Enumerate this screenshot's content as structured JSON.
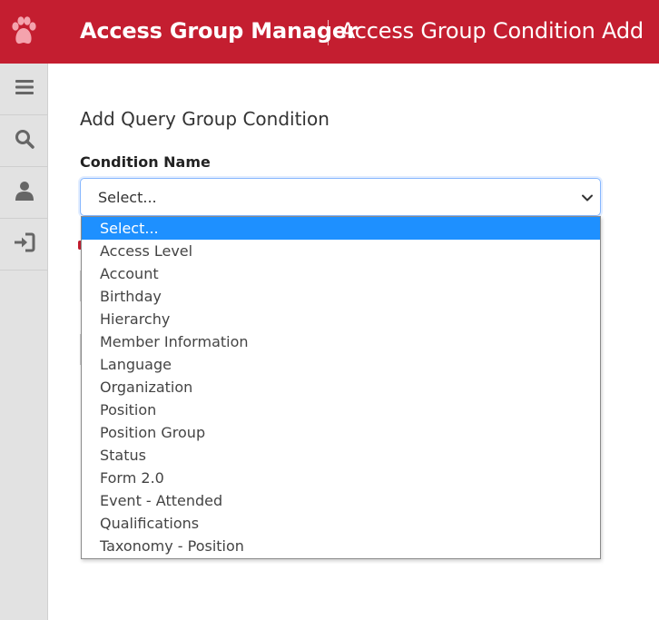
{
  "header": {
    "app_title": "Access Group Manager",
    "page_name": "Access Group Condition Add",
    "logo_icon": "paw-icon",
    "background": "#c41e30"
  },
  "sidebar": {
    "items": [
      {
        "icon": "hamburger-menu-icon"
      },
      {
        "icon": "search-icon"
      },
      {
        "icon": "user-icon"
      },
      {
        "icon": "sign-in-icon"
      }
    ]
  },
  "form": {
    "heading": "Add Query Group Condition",
    "condition_label": "Condition Name",
    "select_value": "Select...",
    "options": [
      "Select...",
      "Access Level",
      "Account",
      "Birthday",
      "Hierarchy",
      "Member Information",
      "Language",
      "Organization",
      "Position",
      "Position Group",
      "Status",
      "Form 2.0",
      "Event - Attended",
      "Qualifications",
      "Taxonomy - Position"
    ],
    "highlighted_option_color": "#1e90ff"
  }
}
